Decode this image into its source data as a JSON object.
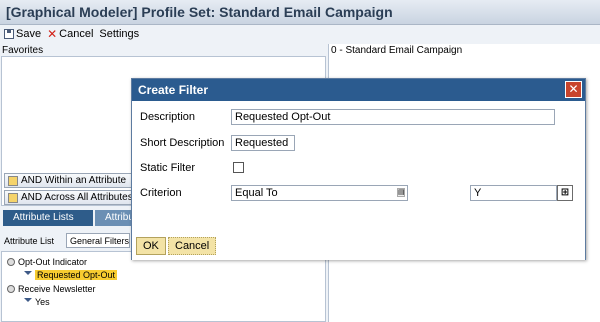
{
  "window": {
    "title": "[Graphical Modeler] Profile Set: Standard Email Campaign"
  },
  "toolbar": {
    "save": "Save",
    "cancel": "Cancel",
    "settings": "Settings"
  },
  "left": {
    "favorites_label": "Favorites",
    "op_within": "AND Within an Attribute",
    "op_across": "AND Across All Attributes",
    "tab_active": "Attribute Lists",
    "tab_inactive": "Attribu",
    "attr_list_label": "Attribute List",
    "attr_list_value": "General Filters",
    "tree": {
      "node1": "Opt-Out Indicator",
      "node1_child": "Requested Opt-Out",
      "node2": "Receive Newsletter",
      "node2_child": "Yes"
    }
  },
  "right": {
    "header": "0 - Standard Email Campaign"
  },
  "dialog": {
    "title": "Create Filter",
    "close": "✕",
    "description_label": "Description",
    "description_value": "Requested Opt-Out",
    "short_label": "Short Description",
    "short_value": "Requested",
    "static_label": "Static Filter",
    "criterion_label": "Criterion",
    "criterion_value": "Equal To",
    "criterion_arrow": "▤",
    "criterion_input": "Y",
    "value_help": "⊞",
    "ok": "OK",
    "cancel": "Cancel"
  }
}
